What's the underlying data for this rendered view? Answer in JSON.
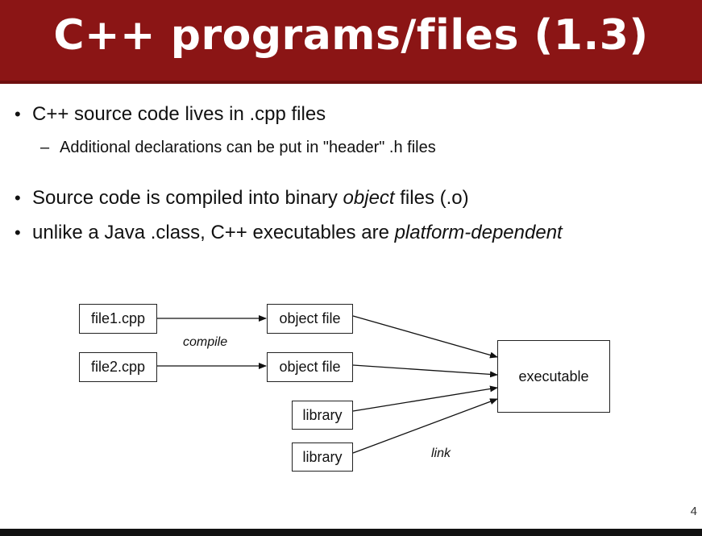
{
  "slide": {
    "title": "C++ programs/files (1.3)",
    "bullets": [
      {
        "text": "C++ source code lives in .cpp files"
      },
      {
        "sub": "Additional declarations can be put in \"header\"  .h files"
      },
      {
        "prefix": "Source code is compiled into binary ",
        "em": "object",
        "suffix": " files  (.o)"
      },
      {
        "prefix": "unlike a Java .class, C++ executables are ",
        "em": "platform-dependent"
      }
    ],
    "bullet_glyph": "•",
    "sub_glyph": "–",
    "page_number": "4"
  },
  "diagram": {
    "boxes": {
      "file1": "file1.cpp",
      "file2": "file2.cpp",
      "obj1": "object file",
      "obj2": "object file",
      "lib1": "library",
      "lib2": "library",
      "exe": "executable"
    },
    "labels": {
      "compile": "compile",
      "link": "link"
    }
  }
}
